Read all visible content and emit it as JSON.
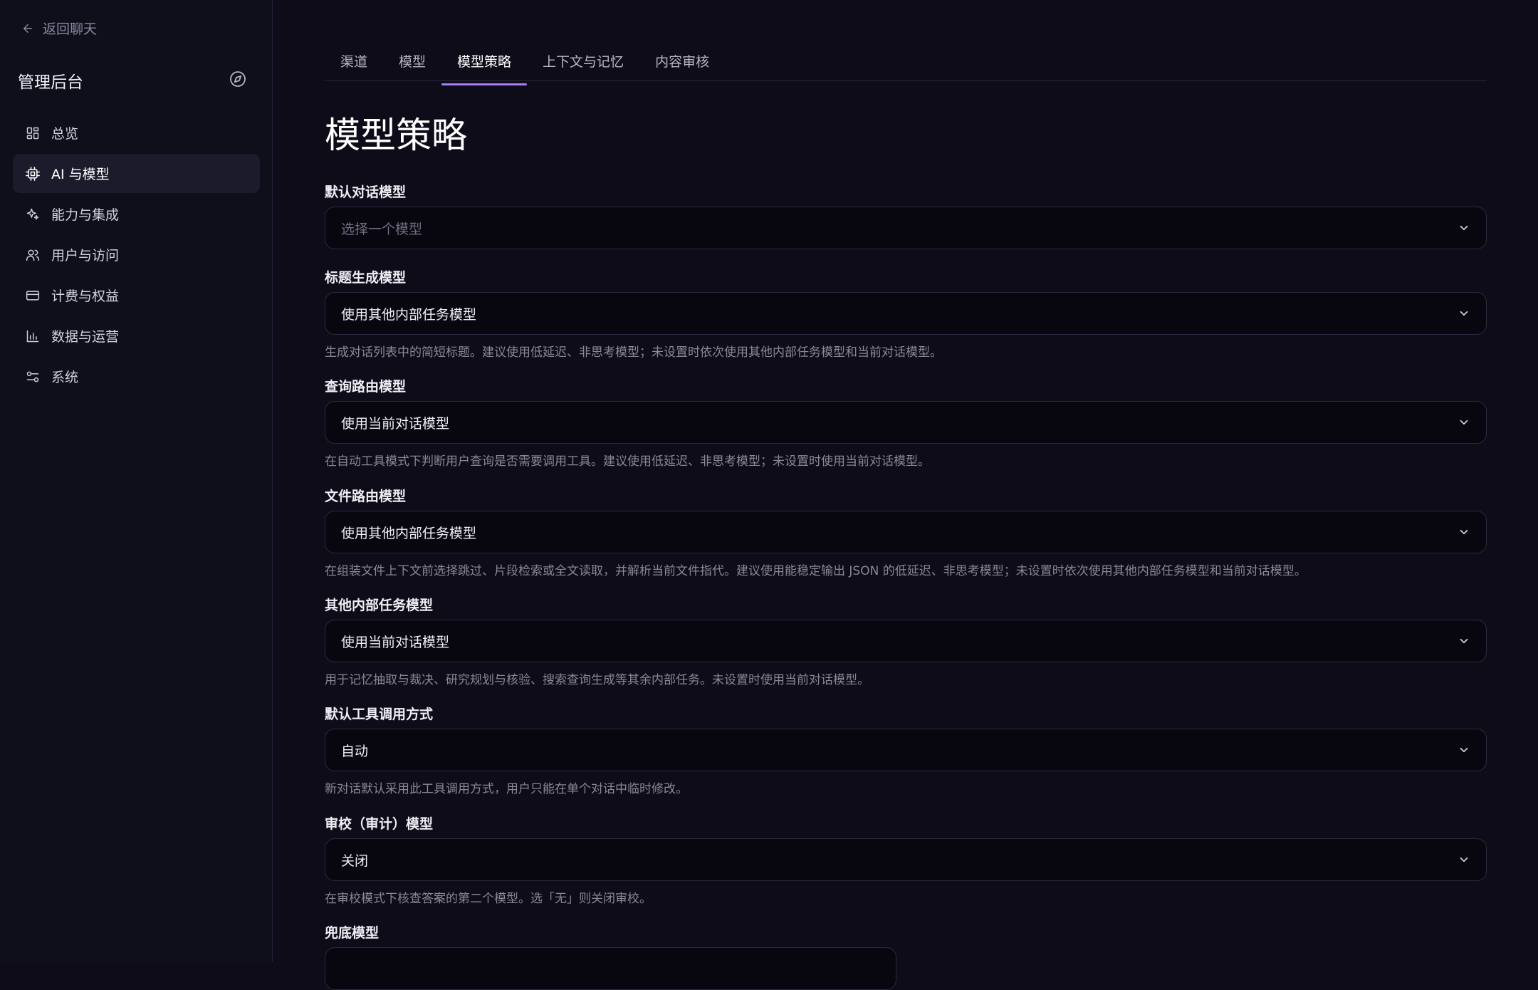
{
  "sidebar": {
    "back_label": "返回聊天",
    "title": "管理后台",
    "items": [
      {
        "label": "总览",
        "icon": "dashboard-icon",
        "active": false
      },
      {
        "label": "AI 与模型",
        "icon": "cpu-chip-icon",
        "active": true
      },
      {
        "label": "能力与集成",
        "icon": "sparkles-icon",
        "active": false
      },
      {
        "label": "用户与访问",
        "icon": "users-icon",
        "active": false
      },
      {
        "label": "计费与权益",
        "icon": "credit-card-icon",
        "active": false
      },
      {
        "label": "数据与运营",
        "icon": "bar-chart-icon",
        "active": false
      },
      {
        "label": "系统",
        "icon": "settings-sliders-icon",
        "active": false
      }
    ]
  },
  "tabs": [
    {
      "label": "渠道",
      "active": false
    },
    {
      "label": "模型",
      "active": false
    },
    {
      "label": "模型策略",
      "active": true
    },
    {
      "label": "上下文与记忆",
      "active": false
    },
    {
      "label": "内容审核",
      "active": false
    }
  ],
  "page_title": "模型策略",
  "fields": [
    {
      "label": "默认对话模型",
      "value": "",
      "placeholder": "选择一个模型",
      "help": ""
    },
    {
      "label": "标题生成模型",
      "value": "使用其他内部任务模型",
      "help": "生成对话列表中的简短标题。建议使用低延迟、非思考模型；未设置时依次使用其他内部任务模型和当前对话模型。"
    },
    {
      "label": "查询路由模型",
      "value": "使用当前对话模型",
      "help": "在自动工具模式下判断用户查询是否需要调用工具。建议使用低延迟、非思考模型；未设置时使用当前对话模型。"
    },
    {
      "label": "文件路由模型",
      "value": "使用其他内部任务模型",
      "help": "在组装文件上下文前选择跳过、片段检索或全文读取，并解析当前文件指代。建议使用能稳定输出 JSON 的低延迟、非思考模型；未设置时依次使用其他内部任务模型和当前对话模型。"
    },
    {
      "label": "其他内部任务模型",
      "value": "使用当前对话模型",
      "help": "用于记忆抽取与裁决、研究规划与核验、搜索查询生成等其余内部任务。未设置时使用当前对话模型。"
    },
    {
      "label": "默认工具调用方式",
      "value": "自动",
      "help": "新对话默认采用此工具调用方式，用户只能在单个对话中临时修改。"
    },
    {
      "label": "审校（审计）模型",
      "value": "关闭",
      "help": "在审校模式下核查答案的第二个模型。选「无」则关闭审校。"
    },
    {
      "label": "兜底模型",
      "value": "",
      "help": ""
    }
  ],
  "colors": {
    "accent": "#a57ff2",
    "background": "#0d0c18",
    "sidebar_bg": "#0f0e1b",
    "active_nav_bg": "#1c1b2b"
  }
}
